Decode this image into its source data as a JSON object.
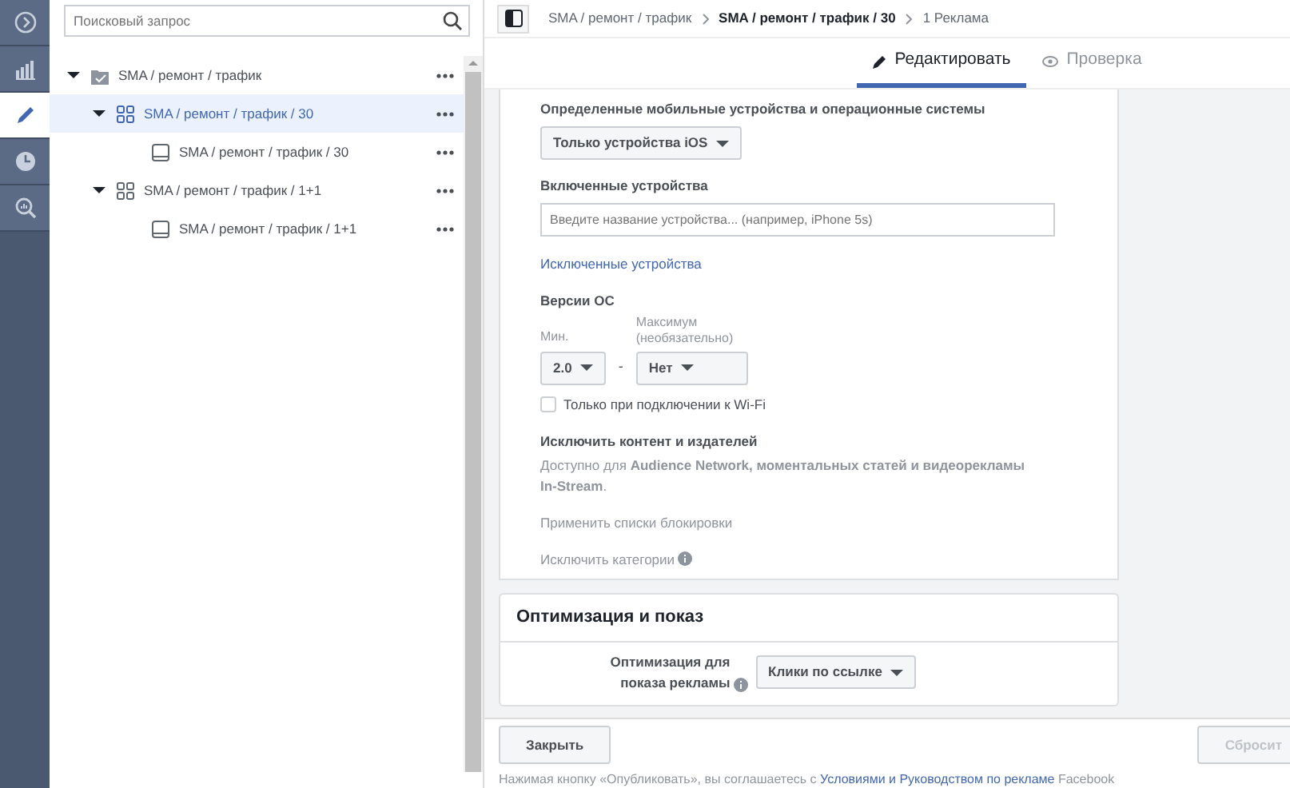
{
  "rail": [
    {
      "kind": "arrow",
      "selected": false
    },
    {
      "kind": "chart",
      "selected": false
    },
    {
      "kind": "pencil",
      "selected": true
    },
    {
      "kind": "clock",
      "selected": false
    },
    {
      "kind": "zoom",
      "selected": false
    }
  ],
  "search": {
    "placeholder": "Поисковый запрос"
  },
  "tree": [
    {
      "kind": "campaign",
      "label": "SMA / ремонт / трафик",
      "selected": false,
      "expanded": true,
      "children": [
        {
          "kind": "adset",
          "label": "SMA / ремонт / трафик / 30",
          "selected": true,
          "expanded": true,
          "children": [
            {
              "kind": "ad",
              "label": "SMA / ремонт / трафик / 30",
              "selected": false
            }
          ]
        },
        {
          "kind": "adset",
          "label": "SMA / ремонт / трафик / 1+1",
          "selected": false,
          "expanded": true,
          "children": [
            {
              "kind": "ad",
              "label": "SMA / ремонт / трафик / 1+1",
              "selected": false
            }
          ]
        }
      ]
    }
  ],
  "breadcrumbs": [
    {
      "label": "SMA / ремонт / трафик",
      "current": false
    },
    {
      "label": "SMA / ремонт / трафик / 30",
      "current": true
    },
    {
      "label": "1 Реклама",
      "current": false
    }
  ],
  "tabs": [
    {
      "label": "Редактировать",
      "kind": "edit",
      "selected": true
    },
    {
      "label": "Проверка",
      "kind": "review",
      "selected": false
    }
  ],
  "devices": {
    "label": "Определенные мобильные устройства и операционные системы",
    "value": "Только устройства iOS"
  },
  "included": {
    "label": "Включенные устройства",
    "placeholder": "Введите название устройства... (например, iPhone 5s)"
  },
  "excluded_link": "Исключенные устройства",
  "os": {
    "label": "Версии ОС",
    "min_label": "Мин.",
    "max_label": "Максимум (необязательно)",
    "min": "2.0",
    "separator": "-",
    "max": "Нет"
  },
  "wifi": {
    "label": "Только при подключении к Wi-Fi",
    "checked": false
  },
  "exclude": {
    "title": "Исключить контент и издателей",
    "text": "Доступно для **Audience Network, моментальных статей и видеорекламы In-Stream**.",
    "block_lists": "Применить списки блокировки",
    "categories": "Исключить категории"
  },
  "optimization": {
    "title": "Оптимизация и показ",
    "label": "Оптимизация для показа рекламы",
    "value": "Клики по ссылке"
  },
  "footer": {
    "close": "Закрыть",
    "reset": "Сбросит",
    "note": "Нажимая кнопку «Опубликовать», вы соглашаетесь с **Условиями и Руководством по рекламе** Facebook"
  }
}
